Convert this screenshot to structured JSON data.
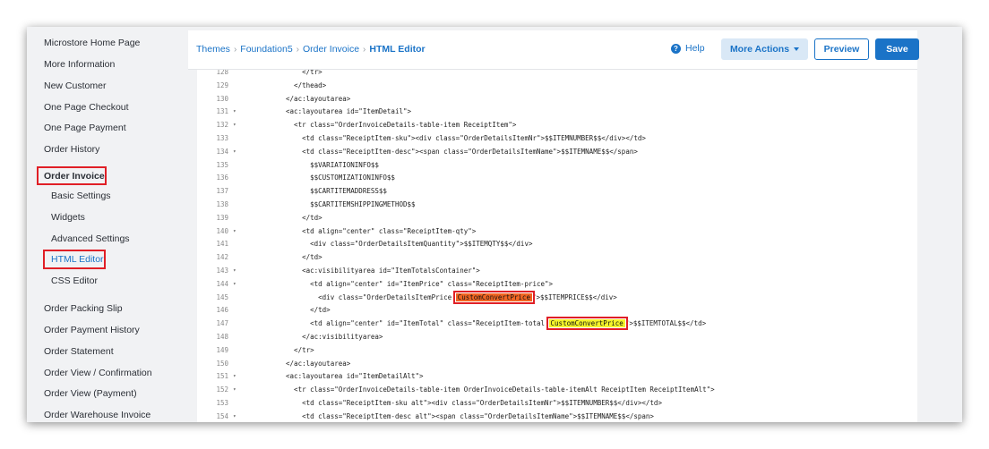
{
  "sidebar": {
    "items": [
      {
        "label": "Microstore Home Page"
      },
      {
        "label": "More Information"
      },
      {
        "label": "New Customer"
      },
      {
        "label": "One Page Checkout"
      },
      {
        "label": "One Page Payment"
      },
      {
        "label": "Order History"
      },
      {
        "label": "Order Invoice"
      },
      {
        "label": "Basic Settings"
      },
      {
        "label": "Widgets"
      },
      {
        "label": "Advanced Settings"
      },
      {
        "label": "HTML Editor"
      },
      {
        "label": "CSS Editor"
      },
      {
        "label": "Order Packing Slip"
      },
      {
        "label": "Order Payment History"
      },
      {
        "label": "Order Statement"
      },
      {
        "label": "Order View / Confirmation"
      },
      {
        "label": "Order View (Payment)"
      },
      {
        "label": "Order Warehouse Invoice"
      }
    ]
  },
  "header": {
    "breadcrumb": [
      "Themes",
      "Foundation5",
      "Order Invoice",
      "HTML Editor"
    ],
    "help_label": "Help",
    "more_actions_label": "More Actions",
    "preview_label": "Preview",
    "save_label": "Save"
  },
  "colors": {
    "accent": "#1a73c7",
    "highlight_box": "#e01f26",
    "highlight_orange": "#f26522",
    "highlight_yellow": "#f5f52a"
  },
  "editor": {
    "lines": [
      {
        "num": "128",
        "fold": "",
        "text": "      </tr>"
      },
      {
        "num": "129",
        "fold": "",
        "text": "    </thead>"
      },
      {
        "num": "130",
        "fold": "",
        "text": "  </ac:layoutarea>"
      },
      {
        "num": "131",
        "fold": "▾",
        "text": "  <ac:layoutarea id=\"ItemDetail\">"
      },
      {
        "num": "132",
        "fold": "▾",
        "text": "    <tr class=\"OrderInvoiceDetails-table-item ReceiptItem\">"
      },
      {
        "num": "133",
        "fold": "",
        "text": "      <td class=\"ReceiptItem-sku\"><div class=\"OrderDetailsItemNr\">$$ITEMNUMBER$$</div></td>"
      },
      {
        "num": "134",
        "fold": "▾",
        "text": "      <td class=\"ReceiptItem-desc\"><span class=\"OrderDetailsItemName\">$$ITEMNAME$$</span>"
      },
      {
        "num": "135",
        "fold": "",
        "text": "        $$VARIATIONINFO$$"
      },
      {
        "num": "136",
        "fold": "",
        "text": "        $$CUSTOMIZATIONINFO$$"
      },
      {
        "num": "137",
        "fold": "",
        "text": "        $$CARTITEMADDRESS$$"
      },
      {
        "num": "138",
        "fold": "",
        "text": "        $$CARTITEMSHIPPINGMETHOD$$"
      },
      {
        "num": "139",
        "fold": "",
        "text": "      </td>"
      },
      {
        "num": "140",
        "fold": "▾",
        "text": "      <td align=\"center\" class=\"ReceiptItem-qty\">"
      },
      {
        "num": "141",
        "fold": "",
        "text": "        <div class=\"OrderDetailsItemQuantity\">$$ITEMQTY$$</div>"
      },
      {
        "num": "142",
        "fold": "",
        "text": "      </td>"
      },
      {
        "num": "143",
        "fold": "▾",
        "text": "      <ac:visibilityarea id=\"ItemTotalsContainer\">"
      },
      {
        "num": "144",
        "fold": "▾",
        "text": "        <td align=\"center\" id=\"ItemPrice\" class=\"ReceiptItem-price\">"
      },
      {
        "num": "145",
        "fold": "",
        "pre": "          <div class=\"OrderDetailsItemPrice ",
        "hl": "CustomConvertPrice",
        "hl_style": "orange",
        "post": "\">$$ITEMPRICE$$</div>"
      },
      {
        "num": "146",
        "fold": "",
        "text": "        </td>"
      },
      {
        "num": "147",
        "fold": "",
        "pre": "        <td align=\"center\" id=\"ItemTotal\" class=\"ReceiptItem-total ",
        "hl": "CustomConvertPrice",
        "hl_style": "yellow",
        "post": "\">$$ITEMTOTAL$$</td>"
      },
      {
        "num": "148",
        "fold": "",
        "text": "      </ac:visibilityarea>"
      },
      {
        "num": "149",
        "fold": "",
        "text": "    </tr>"
      },
      {
        "num": "150",
        "fold": "",
        "text": "  </ac:layoutarea>"
      },
      {
        "num": "151",
        "fold": "▾",
        "text": "  <ac:layoutarea id=\"ItemDetailAlt\">"
      },
      {
        "num": "152",
        "fold": "▾",
        "text": "    <tr class=\"OrderInvoiceDetails-table-item OrderInvoiceDetails-table-itemAlt ReceiptItem ReceiptItemAlt\">"
      },
      {
        "num": "153",
        "fold": "",
        "text": "      <td class=\"ReceiptItem-sku alt\"><div class=\"OrderDetailsItemNr\">$$ITEMNUMBER$$</div></td>"
      },
      {
        "num": "154",
        "fold": "▾",
        "text": "      <td class=\"ReceiptItem-desc alt\"><span class=\"OrderDetailsItemName\">$$ITEMNAME$$</span>"
      }
    ]
  }
}
